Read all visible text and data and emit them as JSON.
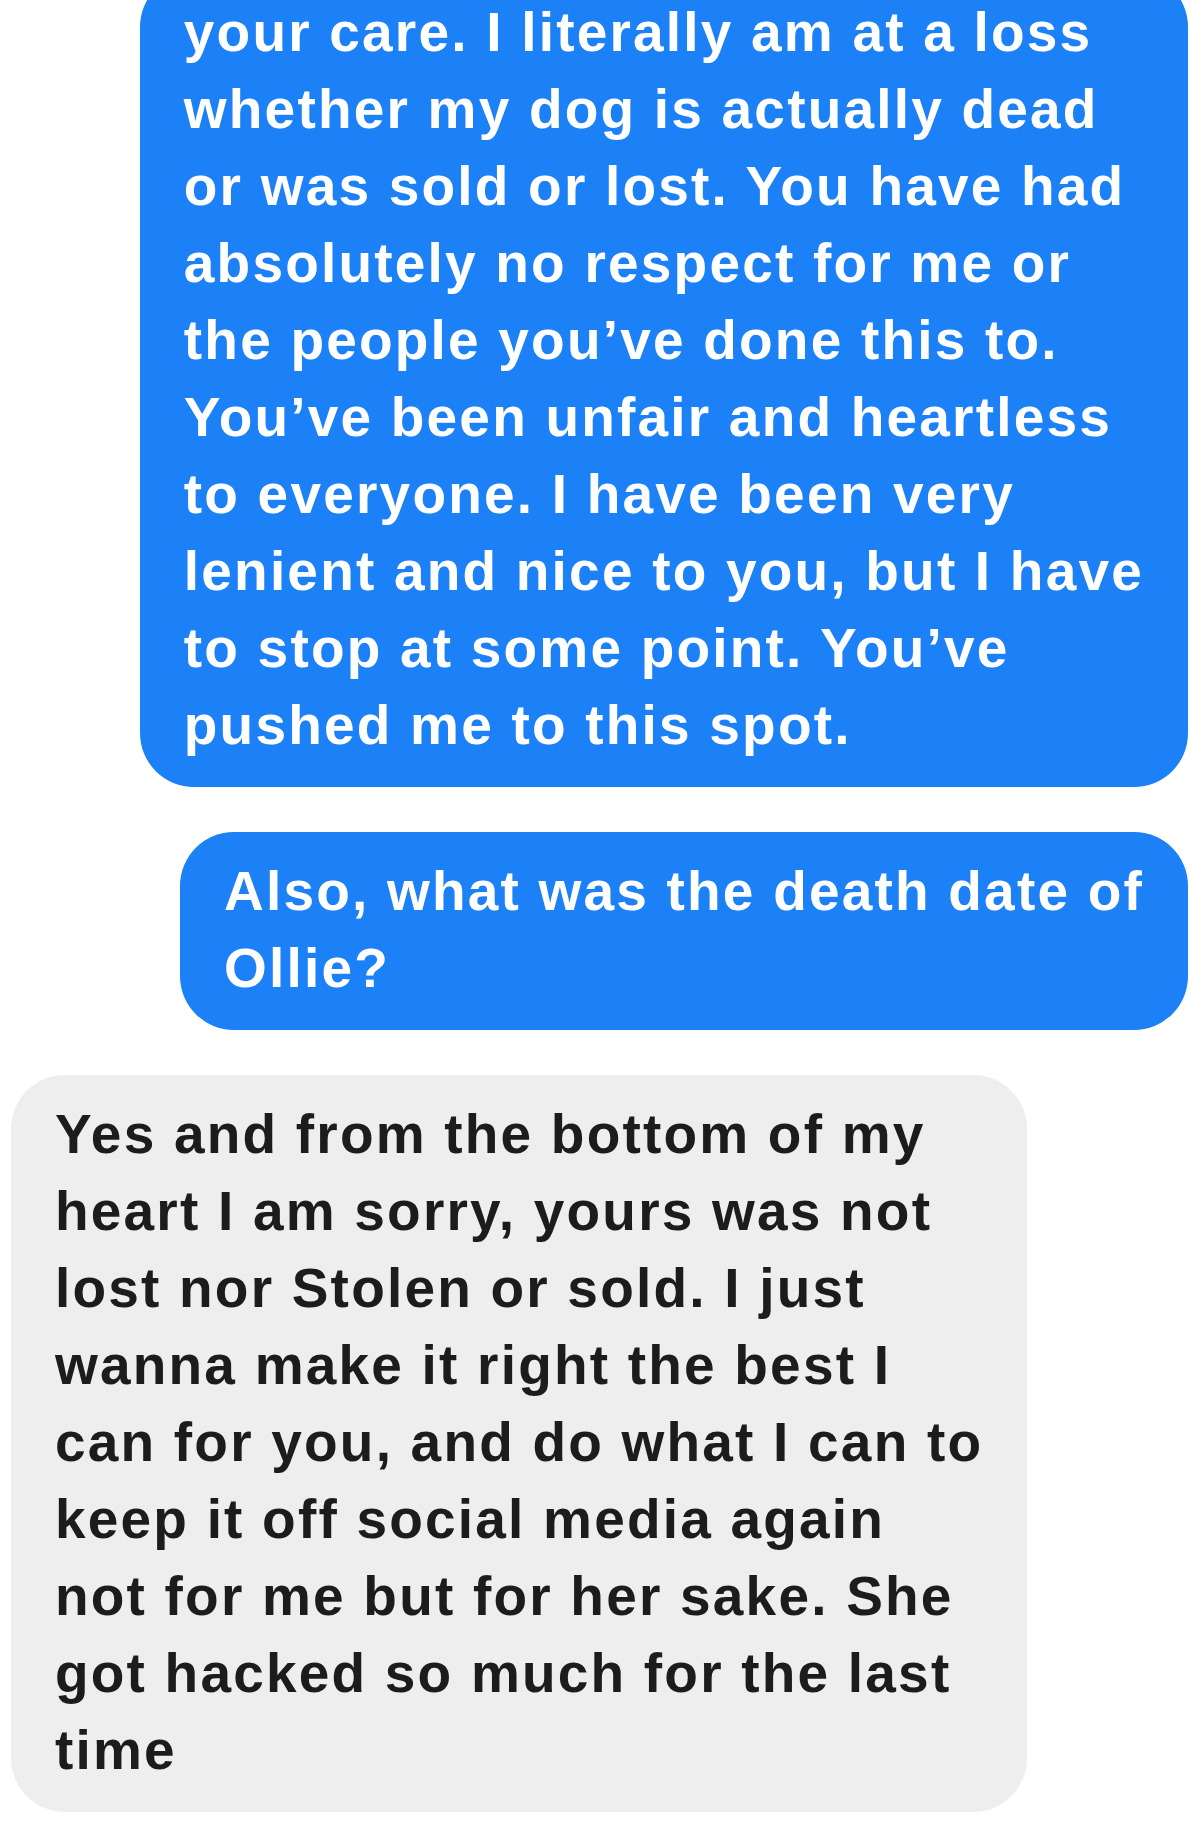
{
  "messages": [
    {
      "kind": "outgoing",
      "text": "your care. I literally am at a loss\nwhether my dog is actually dead\nor was sold or lost. You have had\nabsolutely no respect for me or\nthe people you’ve done this to.\nYou’ve been unfair and heartless\nto everyone. I have been very\nlenient and nice to you, but I have\nto stop at some point. You’ve\npushed me to this spot."
    },
    {
      "kind": "outgoing",
      "text": "Also, what was the death date of\nOllie?"
    },
    {
      "kind": "incoming",
      "text": "Yes and from the bottom of my\nheart I am sorry, yours was not\nlost nor Stolen or sold. I just\nwanna make it right the best I\ncan for you, and do what I can to\nkeep it off social media again\nnot for me but for her sake. She\ngot hacked so much for the last\ntime"
    }
  ]
}
